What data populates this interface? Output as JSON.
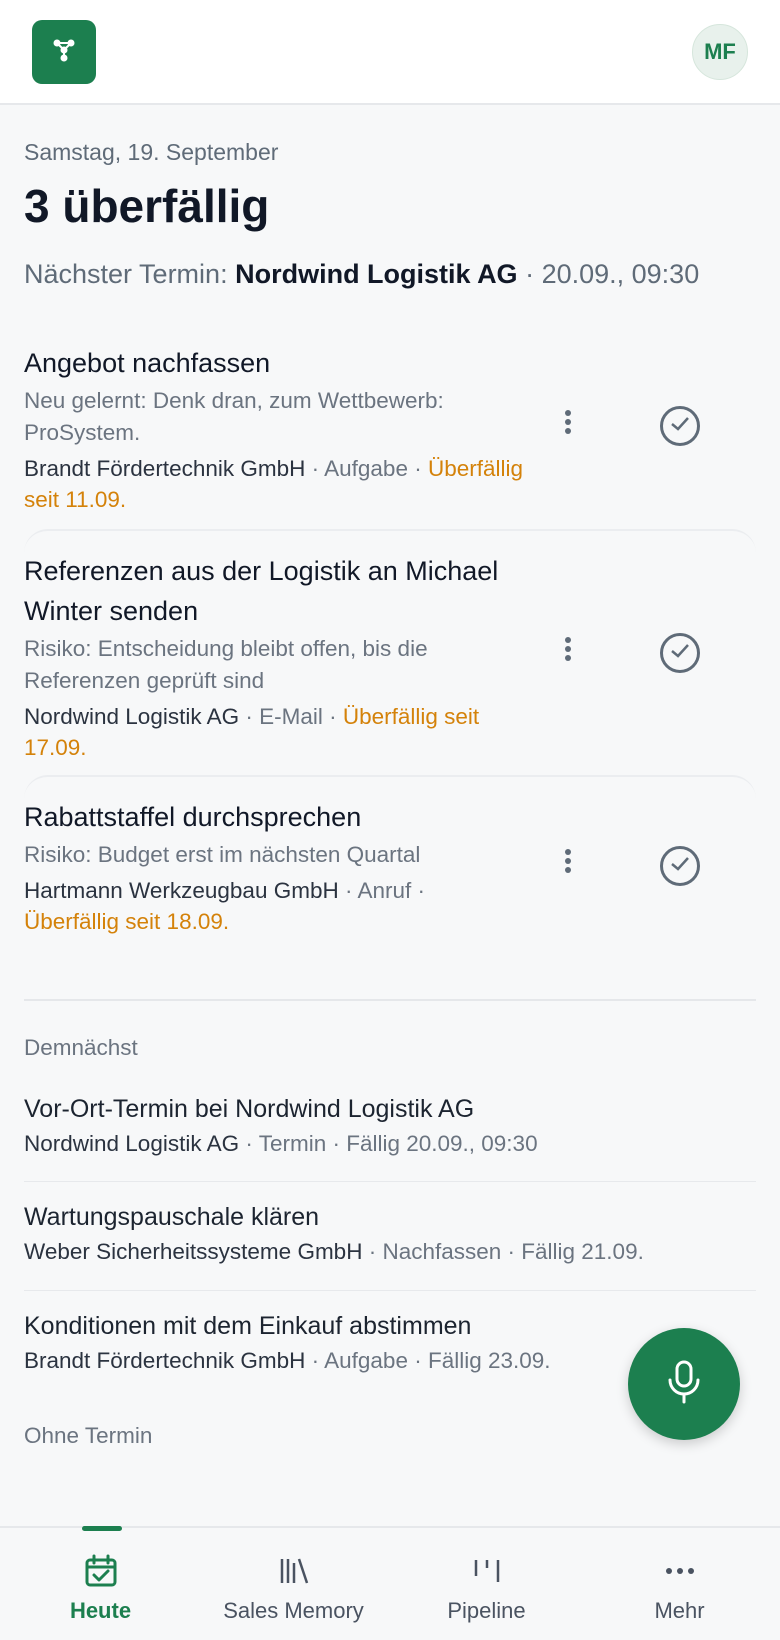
{
  "header": {
    "logo_icon": "network-nodes-icon",
    "avatar_initials": "MF"
  },
  "summary": {
    "date": "Samstag, 19. September",
    "headline": "3 überfällig",
    "next_label": "Nächster Termin: ",
    "next_company": "Nordwind Logistik AG",
    "next_time": " · 20.09., 09:30"
  },
  "overdue_tasks": [
    {
      "title": "Angebot nachfassen",
      "subtitle": "Neu gelernt: Denk dran, zum Wettbewerb: ProSystem.",
      "company": "Brandt Fördertechnik GmbH",
      "type": " · Aufgabe · ",
      "due": "Überfällig seit 11.09."
    },
    {
      "title": "Referenzen aus der Logistik an Michael Winter senden",
      "subtitle": "Risiko: Entscheidung bleibt offen, bis die Referenzen geprüft sind",
      "company": "Nordwind Logistik AG",
      "type": " · E-Mail · ",
      "due": "Überfällig seit 17.09."
    },
    {
      "title": "Rabattstaffel durchsprechen",
      "subtitle": "Risiko: Budget erst im nächsten Quartal",
      "company": "Hartmann Werkzeugbau GmbH",
      "type": " · Anruf · ",
      "due": "Überfällig seit 18.09."
    }
  ],
  "upcoming": {
    "heading": "Demnächst",
    "items": [
      {
        "title": "Vor-Ort-Termin bei Nordwind Logistik AG",
        "company": "Nordwind Logistik AG",
        "rest": " · Termin · Fällig 20.09., 09:30"
      },
      {
        "title": "Wartungspauschale klären",
        "company": "Weber Sicherheitssysteme GmbH",
        "rest": " · Nachfassen · Fällig 21.09."
      },
      {
        "title": "Konditionen mit dem Einkauf abstimmen",
        "company": "Brandt Fördertechnik GmbH",
        "rest": " · Aufgabe · Fällig 23.09."
      }
    ]
  },
  "no_date_heading": "Ohne Termin",
  "fab_icon": "microphone-icon",
  "nav": [
    {
      "label": "Heute",
      "icon": "calendar-check-icon",
      "active": true
    },
    {
      "label": "Sales Memory",
      "icon": "library-icon",
      "active": false
    },
    {
      "label": "Pipeline",
      "icon": "pipeline-icon",
      "active": false
    },
    {
      "label": "Mehr",
      "icon": "more-icon",
      "active": false
    }
  ],
  "colors": {
    "brand": "#1c7f4f",
    "overdue": "#d4820a"
  }
}
